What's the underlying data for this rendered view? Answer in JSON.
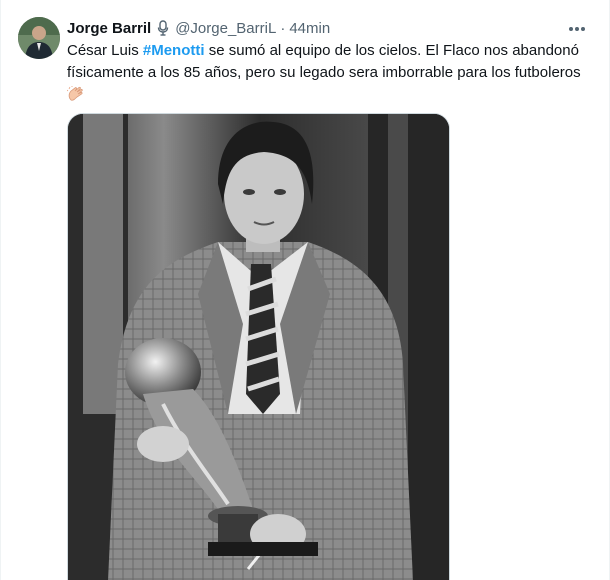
{
  "tweet": {
    "author_name": "Jorge Barril",
    "handle": "@Jorge_BarriL",
    "separator": "·",
    "time": "44min",
    "text_part1": "César Luis ",
    "hashtag": "#Menotti",
    "text_part2": " se sumó al equipo de los cielos. El Flaco nos abandonó físicamente a los 85 años, pero su legado sera imborrable para los futboleros",
    "emoji": "clapping-hands",
    "more_icon": "more-horizontal-icon",
    "badge_icon": "microphone-icon"
  },
  "colors": {
    "link": "#1d9bf0",
    "text": "#0f1419",
    "secondary": "#536471",
    "border": "#cfd9de"
  }
}
